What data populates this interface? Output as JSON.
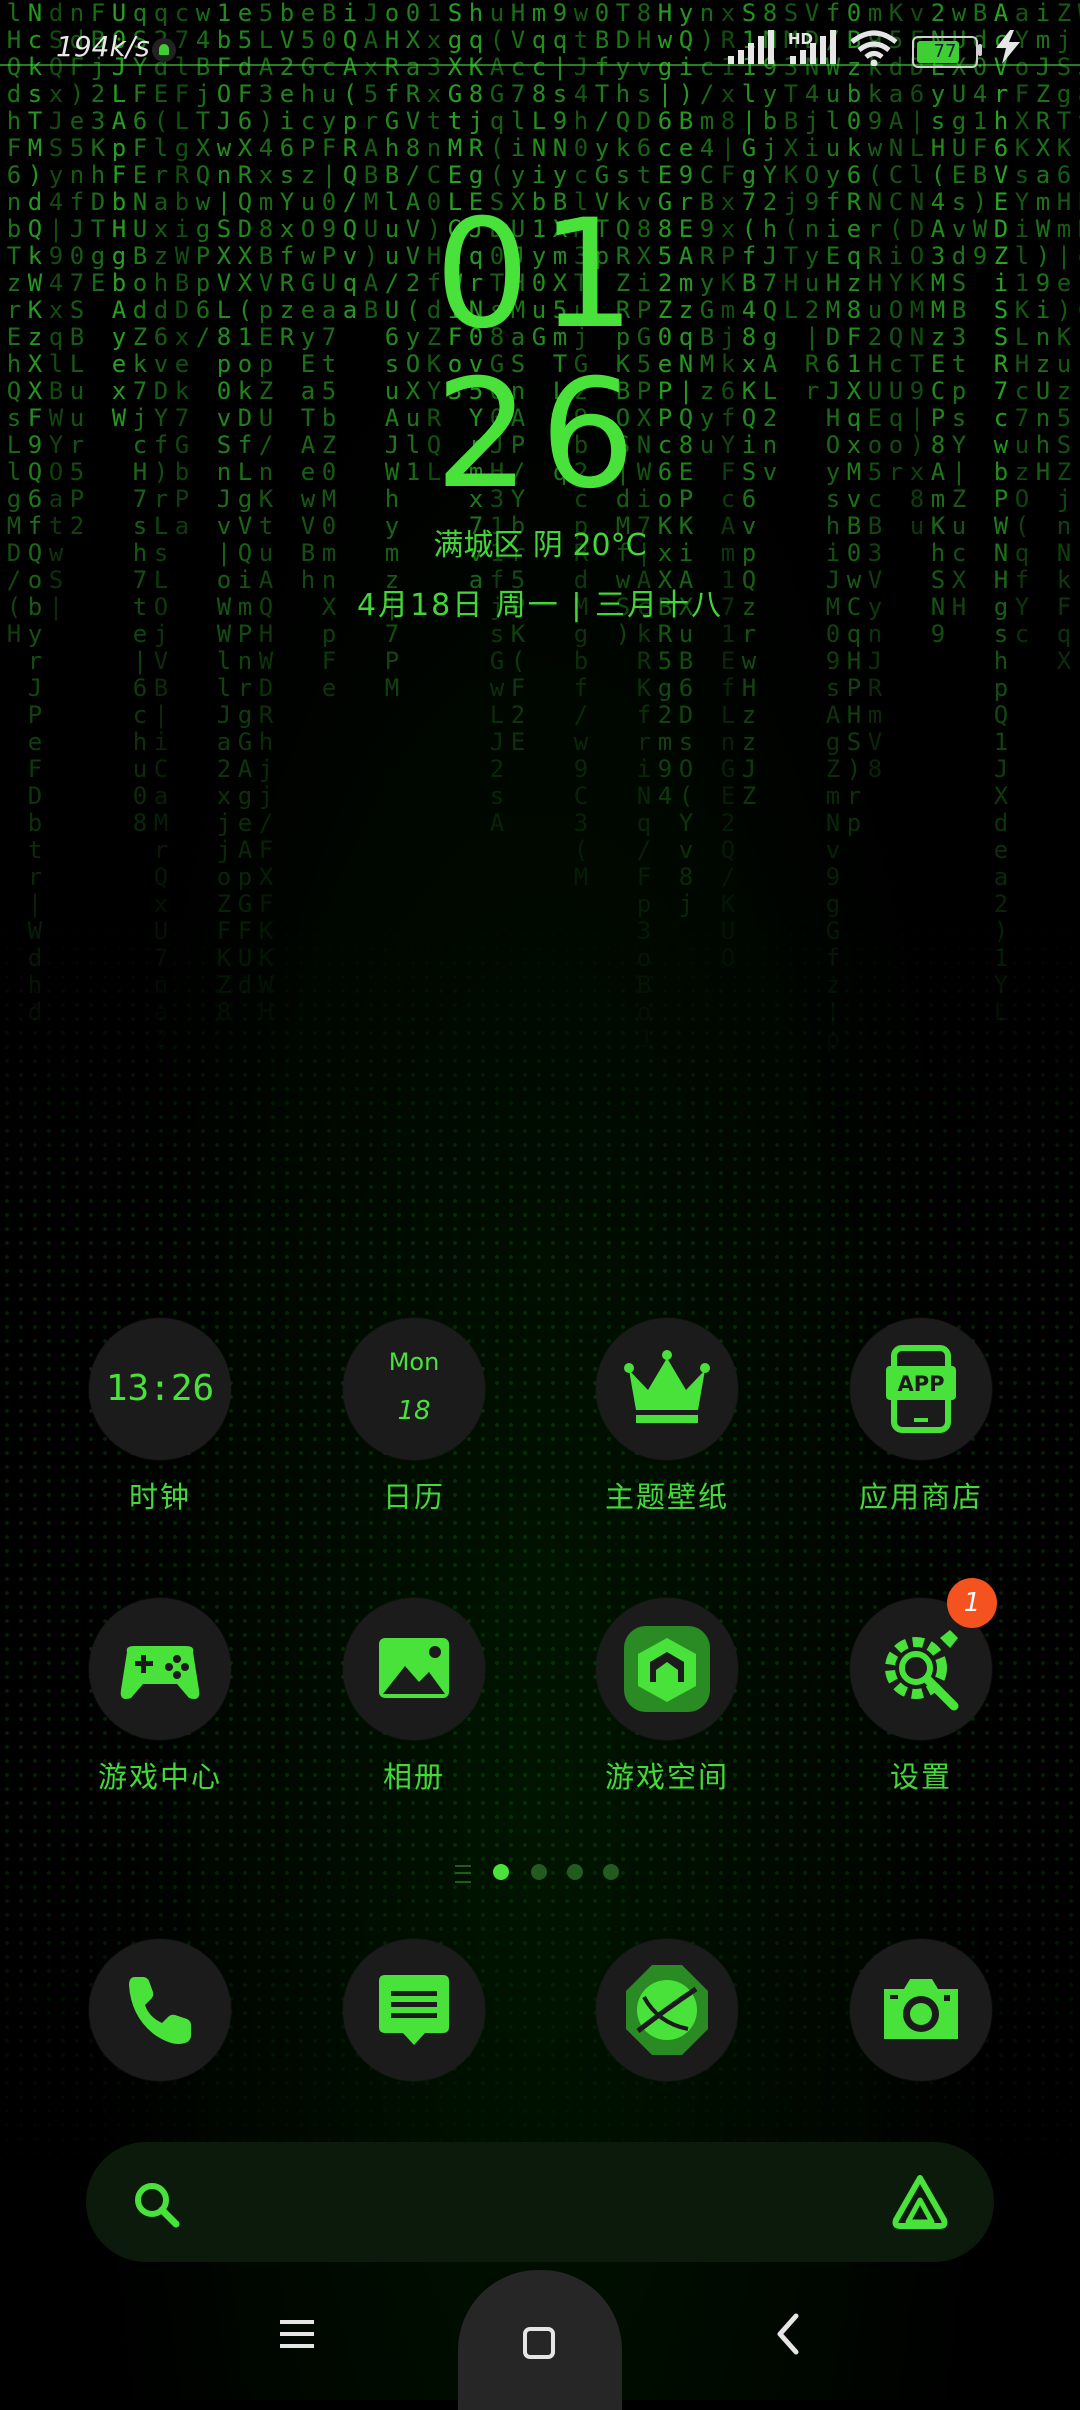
{
  "status_bar": {
    "network_speed": "194k/s",
    "signal_label": "HD",
    "battery_level": "77"
  },
  "clock_widget": {
    "hour": "01",
    "minute": "26",
    "location_weather": "满城区 阴 20°C",
    "date": "4月18日 周一 | 三月十八"
  },
  "apps_row1": [
    {
      "label": "时钟",
      "icon": "clock-icon",
      "display": "13:26"
    },
    {
      "label": "日历",
      "icon": "calendar-icon",
      "weekday": "Mon",
      "day": "18"
    },
    {
      "label": "主题壁纸",
      "icon": "crown-icon"
    },
    {
      "label": "应用商店",
      "icon": "app-store-icon",
      "text": "APP"
    }
  ],
  "apps_row2": [
    {
      "label": "游戏中心",
      "icon": "gamepad-icon"
    },
    {
      "label": "相册",
      "icon": "gallery-icon"
    },
    {
      "label": "游戏空间",
      "icon": "game-space-icon"
    },
    {
      "label": "设置",
      "icon": "settings-icon",
      "badge": "1"
    }
  ],
  "dock": [
    {
      "name": "phone",
      "icon": "phone-icon"
    },
    {
      "name": "messages",
      "icon": "message-icon"
    },
    {
      "name": "browser",
      "icon": "browser-icon"
    },
    {
      "name": "camera",
      "icon": "camera-icon"
    }
  ],
  "pager": {
    "pages": 4,
    "active": 1
  },
  "search_bar": {
    "left_icon": "search-icon",
    "right_icon": "assistant-icon"
  },
  "nav_bar": {
    "items": [
      "menu-icon",
      "home-icon",
      "back-icon"
    ]
  },
  "colors": {
    "accent": "#49e23a",
    "icon_bg": "#1b1b1b",
    "badge": "#f4521e",
    "background": "#000000"
  }
}
